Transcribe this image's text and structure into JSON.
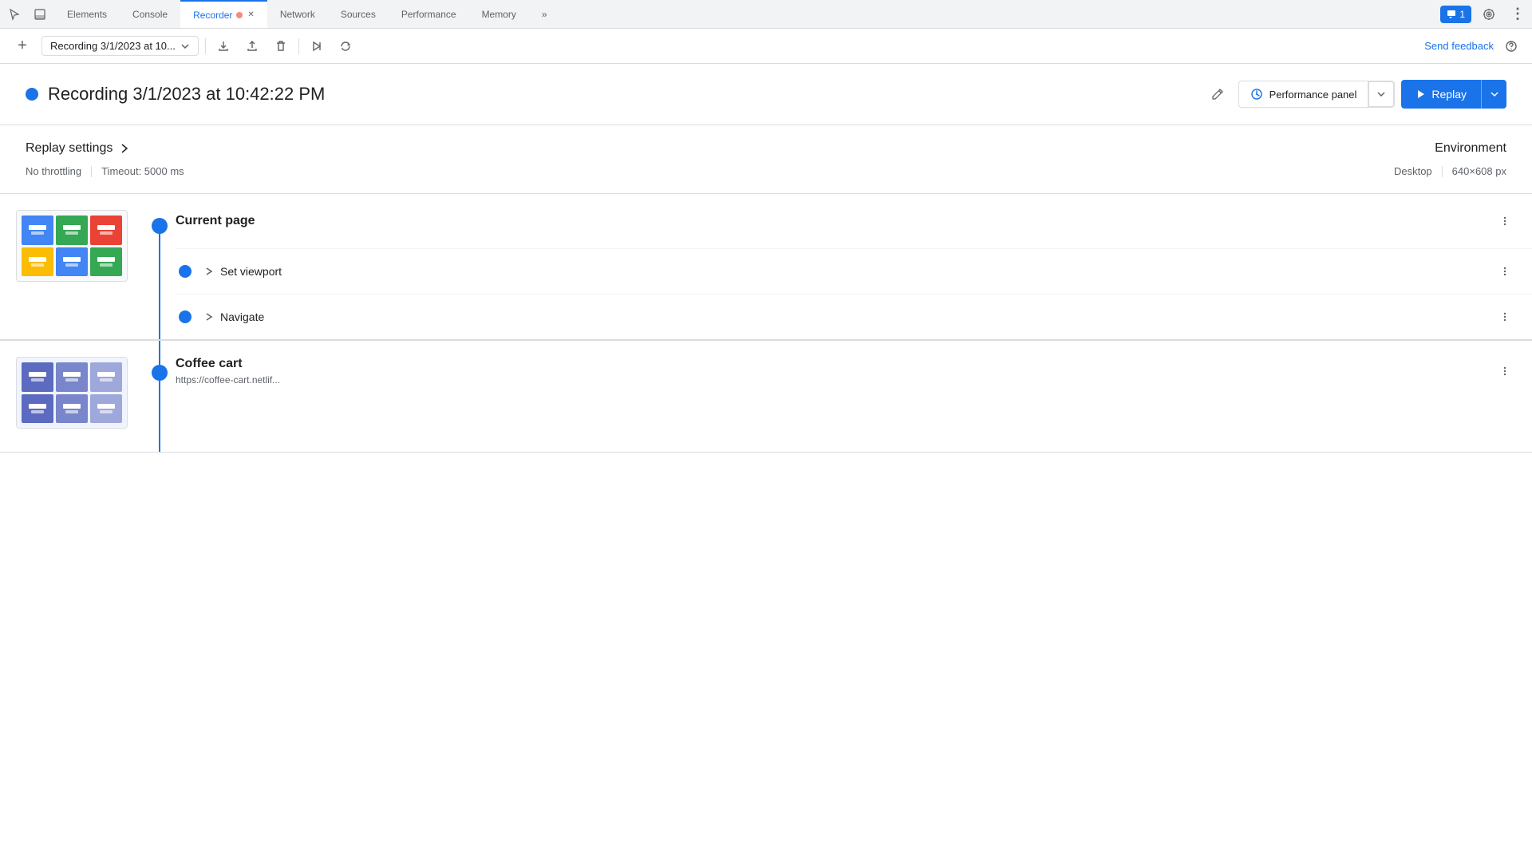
{
  "devtools": {
    "tabs": [
      {
        "id": "elements",
        "label": "Elements",
        "active": false
      },
      {
        "id": "console",
        "label": "Console",
        "active": false
      },
      {
        "id": "recorder",
        "label": "Recorder",
        "active": true,
        "hasClose": true,
        "hasRecordDot": true
      },
      {
        "id": "network",
        "label": "Network",
        "active": false
      },
      {
        "id": "sources",
        "label": "Sources",
        "active": false
      },
      {
        "id": "performance",
        "label": "Performance",
        "active": false
      },
      {
        "id": "memory",
        "label": "Memory",
        "active": false
      }
    ],
    "moreTabsLabel": "»",
    "commentsCount": "1"
  },
  "toolbar": {
    "addLabel": "+",
    "recordingName": "Recording 3/1/2023 at 10...",
    "sendFeedback": "Send feedback"
  },
  "recording": {
    "title": "Recording 3/1/2023 at 10:42:22 PM",
    "performancePanelLabel": "Performance panel",
    "replayLabel": "Replay"
  },
  "replaySettings": {
    "title": "Replay settings",
    "throttling": "No throttling",
    "timeout": "Timeout: 5000 ms",
    "envTitle": "Environment",
    "envType": "Desktop",
    "envSize": "640×608 px"
  },
  "pages": [
    {
      "id": "current-page",
      "title": "Current page",
      "steps": [
        {
          "id": "set-viewport",
          "label": "Set viewport",
          "expandable": true
        },
        {
          "id": "navigate",
          "label": "Navigate",
          "expandable": true
        }
      ]
    },
    {
      "id": "coffee-cart",
      "title": "Coffee cart",
      "url": "https://coffee-cart.netlif...",
      "steps": []
    }
  ],
  "icons": {
    "cursor": "↖",
    "dock": "⊡",
    "plus": "+",
    "upload": "↑",
    "download": "↓",
    "trash": "🗑",
    "play-step": "⊳",
    "refresh": "↺",
    "chevron-down": "▾",
    "chevron-right": "▸",
    "edit": "✎",
    "help": "?",
    "more": "⋮",
    "play": "▶",
    "gear": "⚙",
    "more-tabs": "»",
    "perf-icon": "⚡"
  }
}
